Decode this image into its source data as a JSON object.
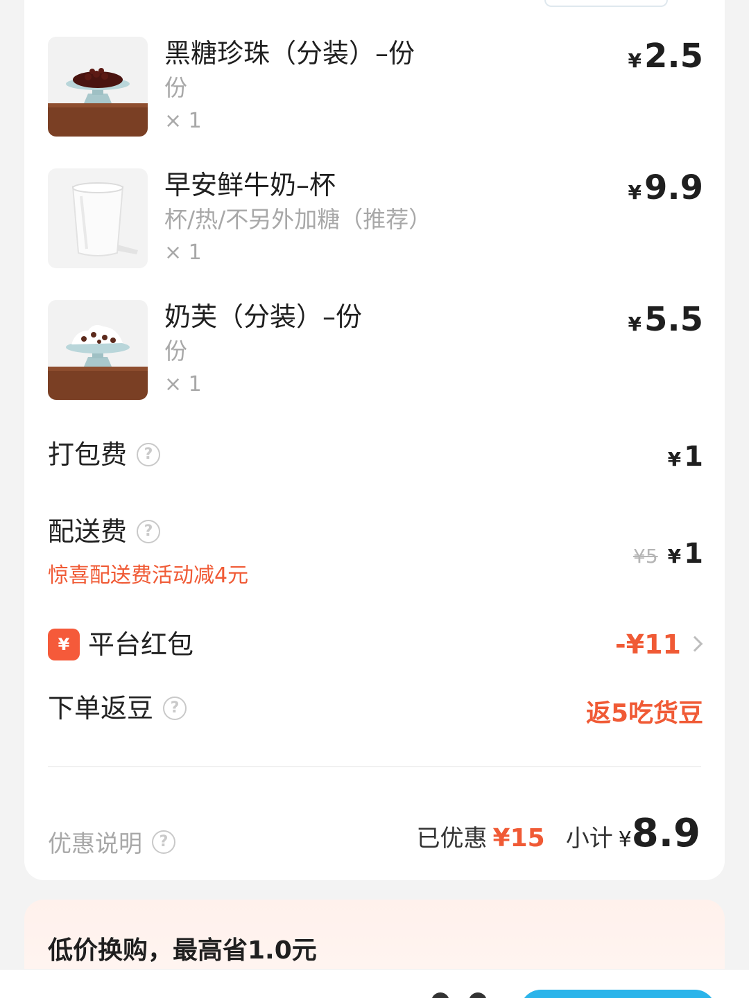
{
  "items": [
    {
      "name": "黑糖珍珠（分装）–份",
      "spec": "份",
      "qty": "× 1",
      "yen": "¥",
      "price": "2.5",
      "image": "brown-sugar-pearl-image"
    },
    {
      "name": "早安鲜牛奶–杯",
      "spec": "杯/热/不另外加糖（推荐）",
      "qty": "× 1",
      "yen": "¥",
      "price": "9.9",
      "image": "fresh-milk-cup-image"
    },
    {
      "name": "奶芙（分装）–份",
      "spec": "份",
      "qty": "× 1",
      "yen": "¥",
      "price": "5.5",
      "image": "milk-foam-image"
    }
  ],
  "packing_fee": {
    "label": "打包费",
    "yen": "¥",
    "value": "1"
  },
  "delivery_fee": {
    "label": "配送费",
    "original": "¥5",
    "yen": "¥",
    "value": "1",
    "promo": "惊喜配送费活动减4元"
  },
  "red_packet": {
    "badge": "¥",
    "label": "平台红包",
    "value": "-¥11"
  },
  "return_beans": {
    "label": "下单返豆",
    "value": "返5吃货豆"
  },
  "summary": {
    "discount_info": "优惠说明",
    "saved_label": "已优惠",
    "saved_value": "¥15",
    "subtotal_label": "小计",
    "yen": "¥",
    "subtotal_value": "8.9"
  },
  "promo_card": {
    "title": "低价换购，最高省1.0元"
  },
  "colors": {
    "accent_red": "#f05a35",
    "badge_red": "#f55a3a",
    "primary_blue": "#2bb4ea"
  },
  "icons": {
    "help": "?"
  }
}
